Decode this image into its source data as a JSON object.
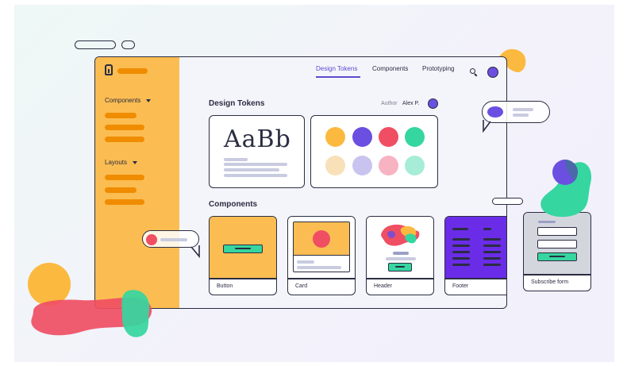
{
  "nav": {
    "items": [
      "Design Tokens",
      "Components",
      "Prototyping"
    ],
    "active": "Design Tokens"
  },
  "sidebar": {
    "sections": [
      {
        "label": "Components",
        "expanded": true
      },
      {
        "label": "Layouts",
        "expanded": true
      }
    ]
  },
  "design_tokens": {
    "title": "Design Tokens",
    "author_label": "Author",
    "author_name": "Alex P.",
    "typography_sample": "AaBb",
    "swatches": [
      "#fbb93f",
      "#6b4fe0",
      "#f04e63",
      "#35d6a0",
      "#f8e0b8",
      "#c9c3f0",
      "#f7b3c2",
      "#a6ecd6"
    ]
  },
  "components": {
    "title": "Components",
    "cards": [
      "Button",
      "Card",
      "Header",
      "Footer",
      "Subscribe form"
    ]
  },
  "colors": {
    "sidebar": "#fbbd52",
    "accent_purple": "#6b4fe0",
    "accent_green": "#35d6a0",
    "accent_red": "#f04e63",
    "accent_orange": "#f08c00",
    "outline": "#2b2d42"
  },
  "icons": [
    "logo-icon",
    "search-icon",
    "caret-down-icon"
  ]
}
